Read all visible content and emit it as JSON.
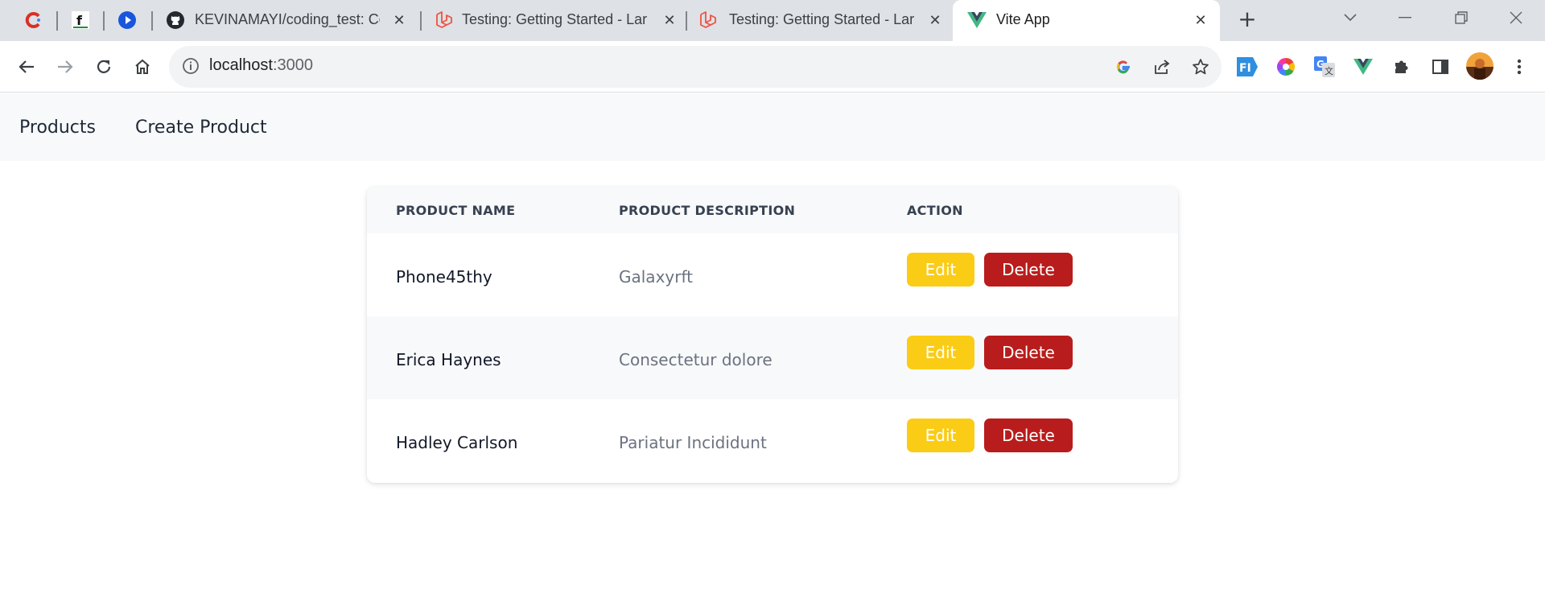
{
  "browser": {
    "tabs": [
      {
        "title": "",
        "icon": "red-c-icon"
      },
      {
        "title": "",
        "icon": "f-letter-icon"
      },
      {
        "title": "",
        "icon": "blue-play-icon"
      },
      {
        "title": "KEVINAMAYI/coding_test: Co",
        "icon": "github-icon"
      },
      {
        "title": "Testing: Getting Started - Lar",
        "icon": "laravel-icon"
      },
      {
        "title": "Testing: Getting Started - Lar",
        "icon": "laravel-icon"
      },
      {
        "title": "Vite App",
        "icon": "vue-icon",
        "active": true
      }
    ],
    "url_host": "localhost",
    "url_port": ":3000"
  },
  "app": {
    "nav": {
      "products": "Products",
      "create_product": "Create Product"
    },
    "table": {
      "headers": {
        "name": "PRODUCT NAME",
        "description": "PRODUCT DESCRIPTION",
        "action": "ACTION"
      },
      "rows": [
        {
          "name": "Phone45thy",
          "description": "Galaxyrft"
        },
        {
          "name": "Erica Haynes",
          "description": "Consectetur dolore"
        },
        {
          "name": "Hadley Carlson",
          "description": "Pariatur Incididunt"
        }
      ],
      "edit_label": "Edit",
      "delete_label": "Delete"
    }
  },
  "colors": {
    "edit": "#facc15",
    "delete": "#b91c1c",
    "nav_bg": "#f8f9fb"
  }
}
